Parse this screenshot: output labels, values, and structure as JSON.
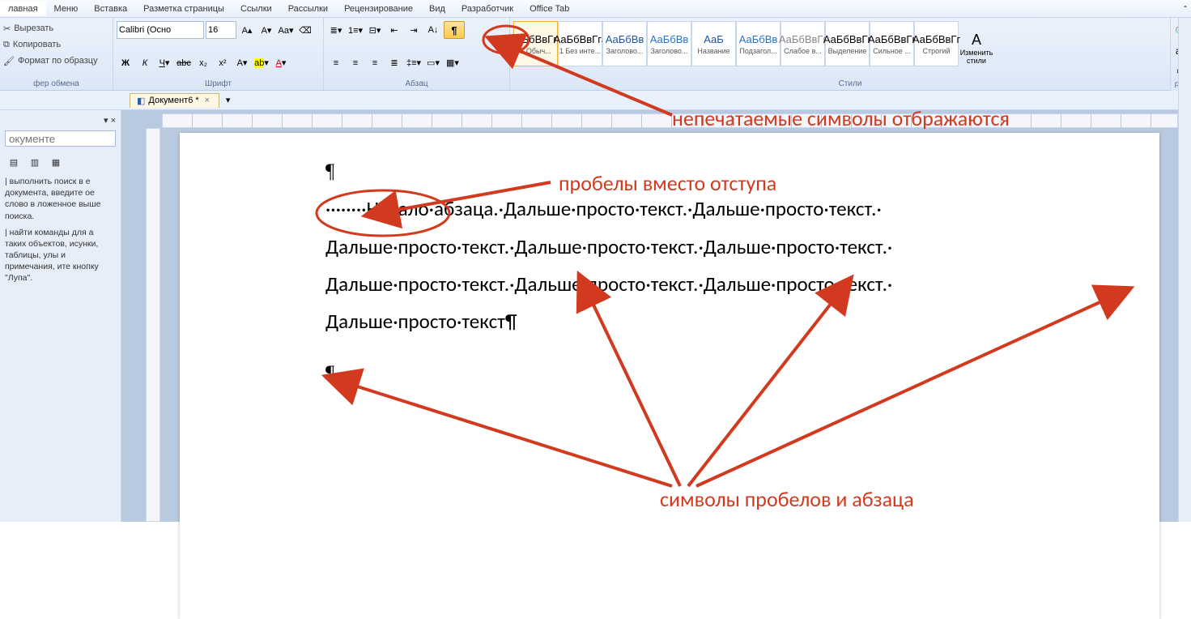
{
  "menu": {
    "items": [
      "лавная",
      "Меню",
      "Вставка",
      "Разметка страницы",
      "Ссылки",
      "Рассылки",
      "Рецензирование",
      "Вид",
      "Разработчик",
      "Office Tab"
    ],
    "active_index": 0
  },
  "clipboard": {
    "cut": "Вырезать",
    "copy": "Копировать",
    "format": "Формат по образцу",
    "group": "фер обмена"
  },
  "font": {
    "name": "Calibri (Осно",
    "size": "16",
    "group": "Шрифт"
  },
  "paragraph": {
    "group": "Абзац"
  },
  "styles": {
    "group": "Стили",
    "items": [
      {
        "sample": "АаБбВвГгJ",
        "sample_color": "#000",
        "name": "1 Обыч..."
      },
      {
        "sample": "АаБбВвГгJ",
        "sample_color": "#000",
        "name": "1 Без инте..."
      },
      {
        "sample": "АаБбВв",
        "sample_color": "#1a55a3",
        "name": "Заголово..."
      },
      {
        "sample": "АаБбВв",
        "sample_color": "#2a72c9",
        "name": "Заголово..."
      },
      {
        "sample": "АаБ",
        "sample_color": "#1a55a3",
        "name": "Название"
      },
      {
        "sample": "АаБбВв",
        "sample_color": "#2a72c9",
        "name": "Подзагол..."
      },
      {
        "sample": "АаБбВвГг",
        "sample_color": "#888",
        "name": "Слабое в..."
      },
      {
        "sample": "АаБбВвГг",
        "sample_color": "#000",
        "name": "Выделение"
      },
      {
        "sample": "АаБбВвГг",
        "sample_color": "#000",
        "name": "Сильное ..."
      },
      {
        "sample": "АаБбВвГг",
        "sample_color": "#000",
        "name": "Строгий"
      }
    ],
    "change": "Изменить стили"
  },
  "doctab": {
    "name": "Документ6 *"
  },
  "leftpanel": {
    "search_placeholder": "окументе",
    "p1": "| выполнить поиск в е документа, введите ое слово в ложенное выше поиска.",
    "p2": "| найти команды для а таких объектов, исунки, таблицы, улы и примечания, ите кнопку \"Лупа\"."
  },
  "doc": {
    "p1": "¶",
    "line1": "········Начало·абзаца.·Дальше·просто·текст.·Дальше·просто·текст.·",
    "line2": "Дальше·просто·текст.·Дальше·просто·текст.·Дальше·просто·текст.·",
    "line3": "Дальше·просто·текст.·Дальше·просто·текст.·Дальше·просто·текст.·",
    "line4": "Дальше·просто·текст¶",
    "p3": "¶"
  },
  "annotations": {
    "a1": "непечатаемые символы отбражаются",
    "a2": "пробелы вместо отступа",
    "a3": "символы пробелов и абзаца"
  }
}
